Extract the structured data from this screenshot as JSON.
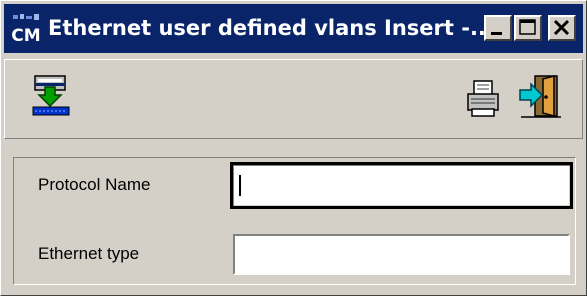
{
  "window": {
    "title": "Ethernet user defined vlans Insert -...",
    "app_icon_text": "CM",
    "controls": {
      "minimize_icon": "minimize-icon",
      "maximize_icon": "maximize-icon",
      "close_icon": "close-icon"
    }
  },
  "toolbar": {
    "left": [
      {
        "icon": "insert-record-icon"
      }
    ],
    "right": [
      {
        "icon": "print-icon"
      },
      {
        "icon": "exit-icon"
      }
    ]
  },
  "form": {
    "fields": [
      {
        "label": "Protocol Name",
        "value": "",
        "focused": true
      },
      {
        "label": "Ethernet type",
        "value": "",
        "focused": false
      }
    ]
  },
  "colors": {
    "titlebar": "#0a246a",
    "title_text": "#ffffff",
    "chrome": "#d4d0c8"
  }
}
